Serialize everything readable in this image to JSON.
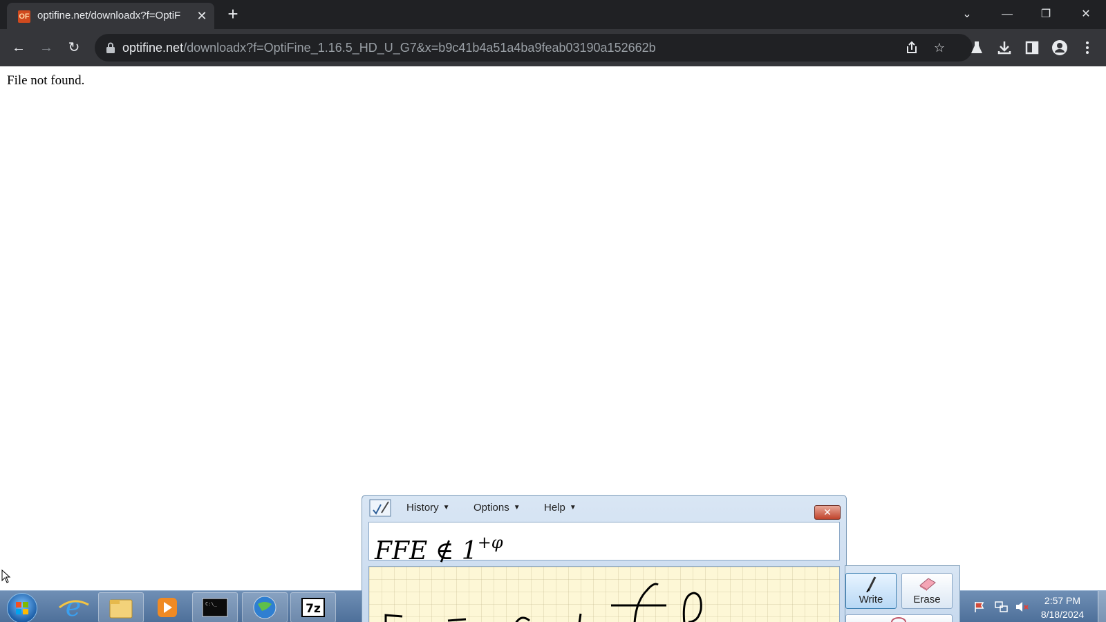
{
  "browser": {
    "tab": {
      "favicon": "OF",
      "title": "optifine.net/downloadx?f=OptiF",
      "close": "✕"
    },
    "new_tab": "+",
    "window_controls": {
      "dropdown": "⌄",
      "minimize": "—",
      "restore": "❐",
      "close": "✕"
    },
    "nav": {
      "back": "←",
      "forward": "→",
      "reload": "↻"
    },
    "url_host": "optifine.net",
    "url_path": "/downloadx?f=OptiFine_1.16.5_HD_U_G7&x=b9c41b4a51a4ba9feab03190a152662b",
    "icons": [
      "share-icon",
      "star-icon",
      "labs-flask-icon",
      "download-icon",
      "side-panel-icon",
      "profile-icon",
      "menu-icon"
    ]
  },
  "page": {
    "message": "File not found."
  },
  "math_panel": {
    "menus": {
      "history": "History",
      "options": "Options",
      "help": "Help"
    },
    "close": "✕",
    "formula_main": "FFE ∉ 1",
    "formula_sup": "+φ",
    "tools": {
      "write": "Write",
      "erase": "Erase"
    }
  },
  "taskbar": {
    "time": "2:57 PM",
    "date": "8/18/2024",
    "pinned": [
      "start-orb",
      "internet-explorer-icon",
      "file-explorer-icon",
      "media-player-icon",
      "command-prompt-icon",
      "network-globe-icon",
      "7zip-icon"
    ]
  }
}
